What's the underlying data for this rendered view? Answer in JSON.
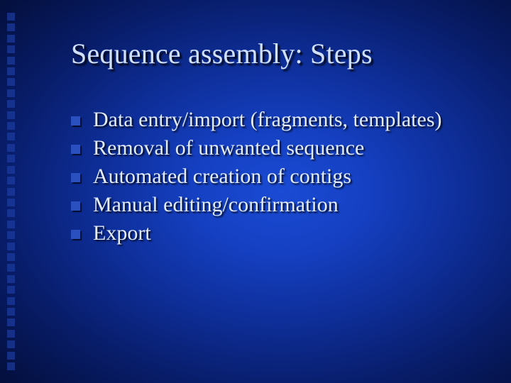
{
  "title": "Sequence assembly: Steps",
  "bullets": [
    "Data entry/import (fragments, templates)",
    "Removal of unwanted sequence",
    "Automated creation of contigs",
    "Manual editing/confirmation",
    "Export"
  ],
  "deco_square_count": 33
}
